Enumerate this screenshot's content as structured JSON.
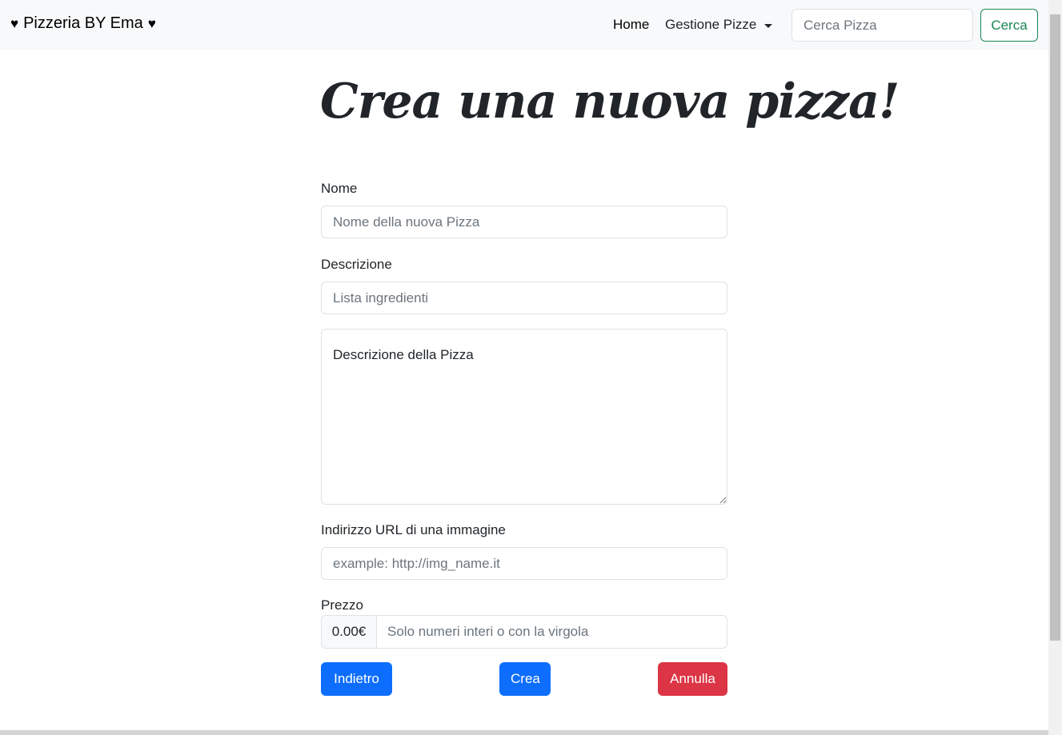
{
  "navbar": {
    "brand_left_icon": "heart-icon",
    "brand_text": "Pizzeria BY Ema",
    "brand_right_icon": "heart-icon",
    "links": [
      {
        "label": "Home"
      },
      {
        "label": "Gestione Pizze",
        "dropdown": true
      }
    ],
    "search": {
      "placeholder": "Cerca Pizza",
      "button_label": "Cerca"
    }
  },
  "page": {
    "title": "Crea una nuova pizza!"
  },
  "form": {
    "nome": {
      "label": "Nome",
      "placeholder": "Nome della nuova Pizza"
    },
    "descrizione": {
      "label": "Descrizione",
      "ingredients_placeholder": "Lista ingredienti",
      "description_placeholder": "Descrizione della Pizza"
    },
    "immagine": {
      "label": "Indirizzo URL di una immagine",
      "placeholder": "example: http://img_name.it"
    },
    "prezzo": {
      "label": "Prezzo",
      "addon": "0.00€",
      "placeholder": "Solo numeri interi o con la virgola"
    },
    "buttons": {
      "back": "Indietro",
      "create": "Crea",
      "cancel": "Annulla"
    }
  },
  "colors": {
    "primary": "#0d6efd",
    "danger": "#dc3545",
    "success": "#198754",
    "navbar_bg": "#f8f9fa"
  }
}
